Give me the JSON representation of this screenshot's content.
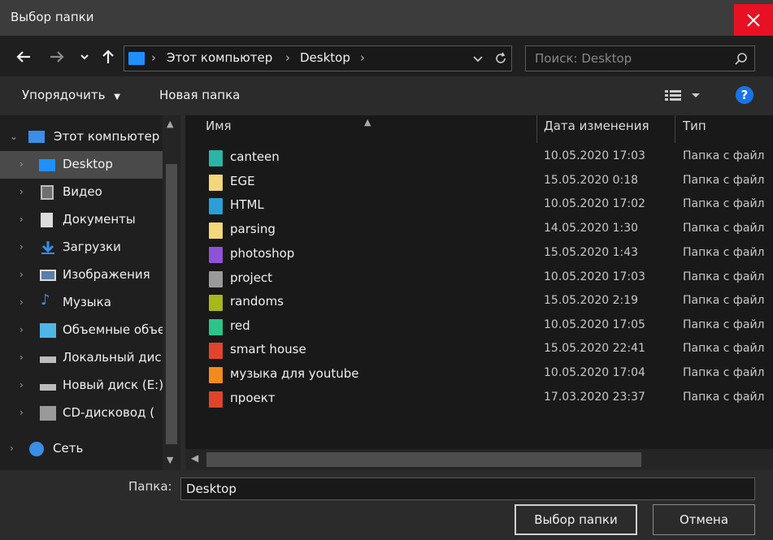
{
  "window": {
    "title": "Выбор папки"
  },
  "address": {
    "crumbs": [
      "Этот компьютер",
      "Desktop"
    ]
  },
  "search": {
    "placeholder": "Поиск: Desktop"
  },
  "toolbar": {
    "organize_label": "Упорядочить",
    "new_folder_label": "Новая папка",
    "help_label": "?"
  },
  "sidebar": {
    "items": [
      {
        "label": "Этот компьютер",
        "icon": "computer-icon",
        "expanded": true
      },
      {
        "label": "Desktop",
        "icon": "desktop-icon",
        "selected": true
      },
      {
        "label": "Видео",
        "icon": "video-icon"
      },
      {
        "label": "Документы",
        "icon": "documents-icon"
      },
      {
        "label": "Загрузки",
        "icon": "downloads-icon"
      },
      {
        "label": "Изображения",
        "icon": "images-icon"
      },
      {
        "label": "Музыка",
        "icon": "music-icon"
      },
      {
        "label": "Объемные объе",
        "icon": "3d-objects-icon"
      },
      {
        "label": "Локальный дис",
        "icon": "local-disk-icon"
      },
      {
        "label": "Новый диск (E:)",
        "icon": "drive-icon"
      },
      {
        "label": "CD-дисковод (",
        "icon": "cd-drive-icon"
      },
      {
        "label": "Сеть",
        "icon": "network-icon"
      }
    ]
  },
  "columns": {
    "name": "Имя",
    "date": "Дата изменения",
    "type": "Тип"
  },
  "files": [
    {
      "name": "canteen",
      "date": "10.05.2020 17:03",
      "type": "Папка с файл",
      "color": "#2bb5a8"
    },
    {
      "name": "EGE",
      "date": "15.05.2020 0:18",
      "type": "Папка с файл",
      "color": "#f4d77a"
    },
    {
      "name": "HTML",
      "date": "10.05.2020 17:02",
      "type": "Папка с файл",
      "color": "#2a9fd6"
    },
    {
      "name": "parsing",
      "date": "14.05.2020 1:30",
      "type": "Папка с файл",
      "color": "#f4d77a"
    },
    {
      "name": "photoshop",
      "date": "15.05.2020 1:43",
      "type": "Папка с файл",
      "color": "#8e52d6"
    },
    {
      "name": "project",
      "date": "10.05.2020 17:03",
      "type": "Папка с файл",
      "color": "#9a9a9a"
    },
    {
      "name": "randoms",
      "date": "15.05.2020 2:19",
      "type": "Папка с файл",
      "color": "#a6b81a"
    },
    {
      "name": "red",
      "date": "10.05.2020 17:05",
      "type": "Папка с файл",
      "color": "#2bc48a"
    },
    {
      "name": "smart house",
      "date": "15.05.2020 22:41",
      "type": "Папка с файл",
      "color": "#e0452c"
    },
    {
      "name": "музыка для youtube",
      "date": "10.05.2020 17:04",
      "type": "Папка с файл",
      "color": "#f28b1c"
    },
    {
      "name": "проект",
      "date": "17.03.2020 23:37",
      "type": "Папка с файл",
      "color": "#e0452c"
    }
  ],
  "footer": {
    "folder_label": "Папка:",
    "folder_value": "Desktop",
    "select_label": "Выбор папки",
    "cancel_label": "Отмена"
  },
  "colors": {
    "accent": "#1e90ff",
    "close": "#e81123"
  }
}
